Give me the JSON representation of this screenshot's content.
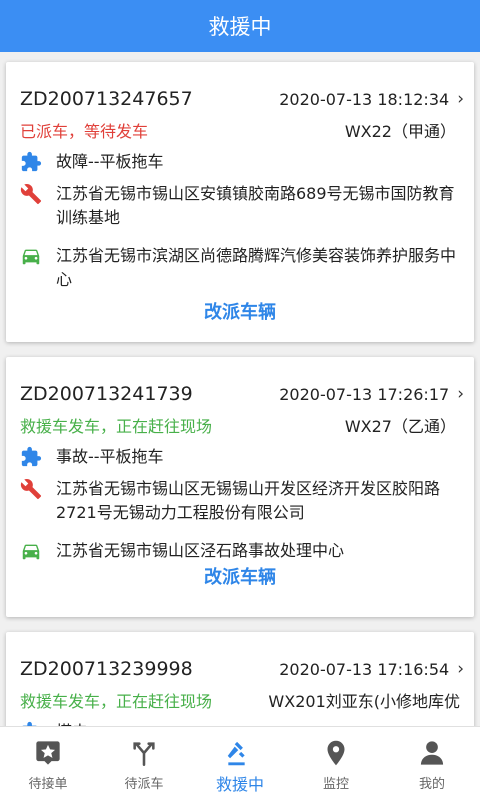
{
  "header": {
    "title": "救援中"
  },
  "colors": {
    "accent": "#3b8ef3",
    "link": "#2f86e8",
    "status_red": "#e0403a",
    "status_green": "#48b04a"
  },
  "orders": [
    {
      "order_no": "ZD200713247657",
      "time": "2020-07-13 18:12:34",
      "status": "已派车，等待发车",
      "status_color": "red",
      "plate": "WX22（甲通）",
      "service": "故障--平板拖车",
      "location": "江苏省无锡市锡山区安镇镇胶南路689号无锡市国防教育训练基地",
      "destination": "江苏省无锡市滨湖区尚德路腾辉汽修美容装饰养护服务中心",
      "action": "改派车辆"
    },
    {
      "order_no": "ZD200713241739",
      "time": "2020-07-13 17:26:17",
      "status": "救援车发车，正在赶往现场",
      "status_color": "green",
      "plate": "WX27（乙通）",
      "service": "事故--平板拖车",
      "location": "江苏省无锡市锡山区无锡锡山开发区经济开发区胶阳路2721号无锡动力工程股份有限公司",
      "destination": "江苏省无锡市锡山区泾石路事故处理中心",
      "action": "改派车辆"
    },
    {
      "order_no": "ZD200713239998",
      "time": "2020-07-13 17:16:54",
      "status": "救援车发车，正在赶往现场",
      "status_color": "green",
      "plate": "WX201刘亚东(小修地库优",
      "service": "搭电"
    }
  ],
  "tabs": [
    {
      "label": "待接单",
      "icon": "pending-order-icon"
    },
    {
      "label": "待派车",
      "icon": "dispatch-icon"
    },
    {
      "label": "救援中",
      "icon": "rescue-icon",
      "active": true
    },
    {
      "label": "监控",
      "icon": "location-pin-icon"
    },
    {
      "label": "我的",
      "icon": "person-icon"
    }
  ]
}
